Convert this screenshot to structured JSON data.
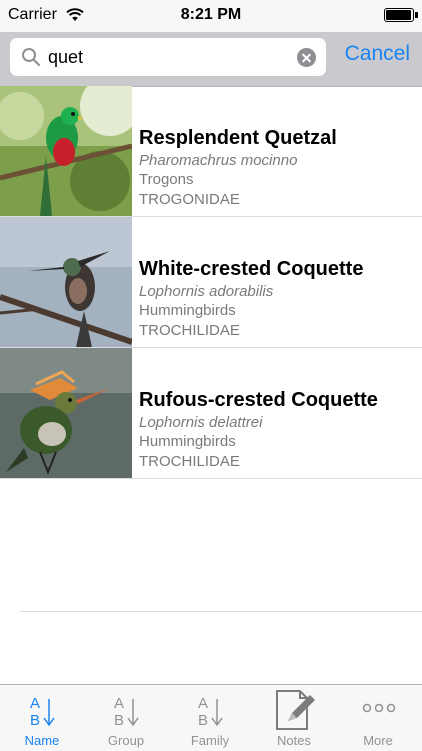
{
  "status_bar": {
    "carrier": "Carrier",
    "time": "8:21 PM",
    "battery_level": 0.95
  },
  "search": {
    "query": "quet",
    "cancel_label": "Cancel"
  },
  "results": [
    {
      "name": "Resplendent Quetzal",
      "scientific": "Pharomachrus mocinno",
      "group": "Trogons",
      "family": "TROGONIDAE"
    },
    {
      "name": "White-crested Coquette",
      "scientific": "Lophornis adorabilis",
      "group": "Hummingbirds",
      "family": "TROCHILIDAE"
    },
    {
      "name": "Rufous-crested Coquette",
      "scientific": "Lophornis delattrei",
      "group": "Hummingbirds",
      "family": "TROCHILIDAE"
    }
  ],
  "tabs": [
    {
      "label": "Name",
      "icon": "sort-ab-icon",
      "active": true
    },
    {
      "label": "Group",
      "icon": "sort-ab-icon",
      "active": false
    },
    {
      "label": "Family",
      "icon": "sort-ab-icon",
      "active": false
    },
    {
      "label": "Notes",
      "icon": "notes-icon",
      "active": false
    },
    {
      "label": "More",
      "icon": "more-icon",
      "active": false
    }
  ],
  "colors": {
    "accent": "#1a84f2",
    "inactive": "#929292",
    "searchbar_bg": "#c9c9ce"
  }
}
